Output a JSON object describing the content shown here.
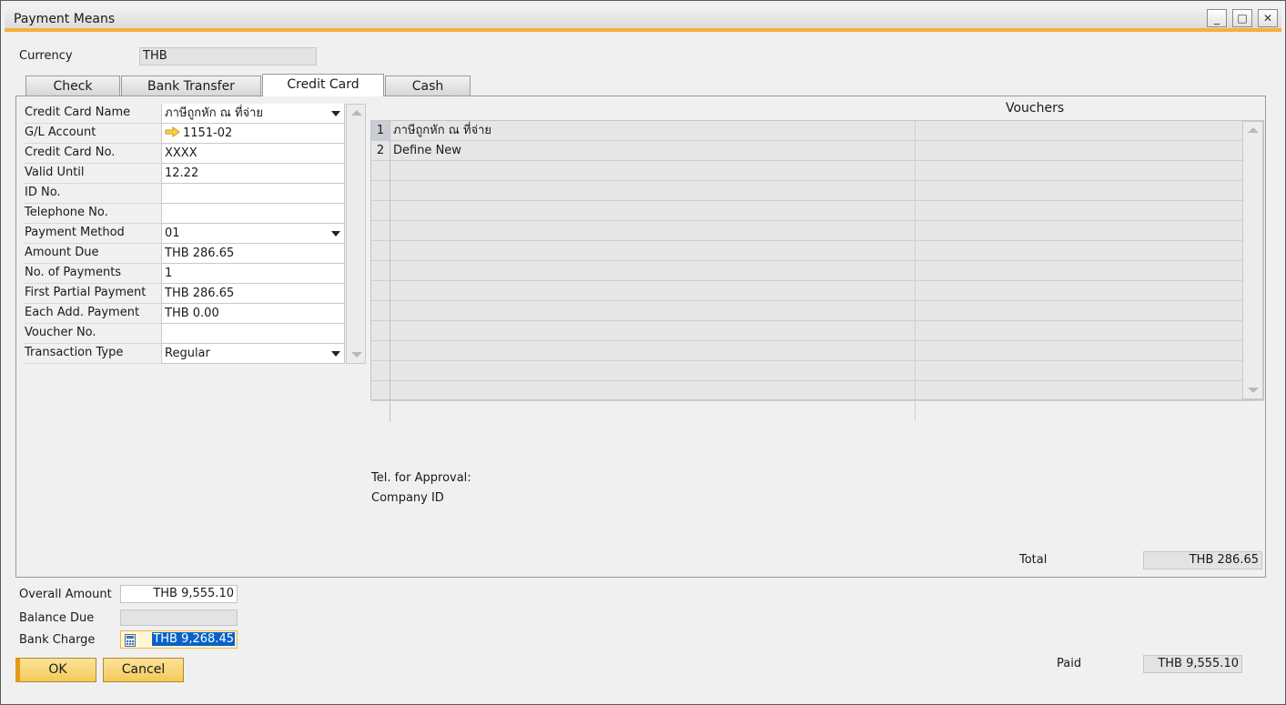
{
  "window": {
    "title": "Payment Means",
    "controls": [
      "_",
      "□",
      "✕"
    ]
  },
  "currency": {
    "label": "Currency",
    "value": "THB"
  },
  "tabs": [
    {
      "label": "Check"
    },
    {
      "label": "Bank Transfer"
    },
    {
      "label": "Credit Card"
    },
    {
      "label": "Cash"
    }
  ],
  "credit_card_form": {
    "rows": [
      {
        "label": "Credit Card Name",
        "value": "ภาษีถูกหัก ณ ที่จ่าย"
      },
      {
        "label": "G/L Account",
        "value": "1151-02"
      },
      {
        "label": "Credit Card No.",
        "value": "XXXX"
      },
      {
        "label": "Valid Until",
        "value": "12.22"
      },
      {
        "label": "ID No.",
        "value": ""
      },
      {
        "label": "Telephone No.",
        "value": ""
      },
      {
        "label": "Payment Method",
        "value": "01"
      },
      {
        "label": "Amount Due",
        "value": "THB 286.65"
      },
      {
        "label": "No. of Payments",
        "value": "1"
      },
      {
        "label": "First Partial Payment",
        "value": "THB 286.65"
      },
      {
        "label": "Each Add. Payment",
        "value": "THB 0.00"
      },
      {
        "label": "Voucher No.",
        "value": ""
      },
      {
        "label": "Transaction Type",
        "value": "Regular"
      }
    ]
  },
  "vouchers": {
    "title": "Vouchers",
    "rows": [
      {
        "num": "1",
        "text": "ภาษีถูกหัก ณ ที่จ่าย"
      },
      {
        "num": "2",
        "text": "Define New"
      }
    ]
  },
  "approval": {
    "tel_label": "Tel. for Approval:",
    "company_label": "Company ID"
  },
  "total": {
    "label": "Total",
    "value": "THB 286.65"
  },
  "overall_amount": {
    "label": "Overall Amount",
    "value": "THB 9,555.10"
  },
  "balance_due": {
    "label": "Balance Due",
    "value": ""
  },
  "bank_charge": {
    "label": "Bank Charge",
    "value": "THB 9,268.45"
  },
  "paid": {
    "label": "Paid",
    "value": "THB 9,555.10"
  },
  "buttons": {
    "ok": "OK",
    "cancel": "Cancel"
  }
}
